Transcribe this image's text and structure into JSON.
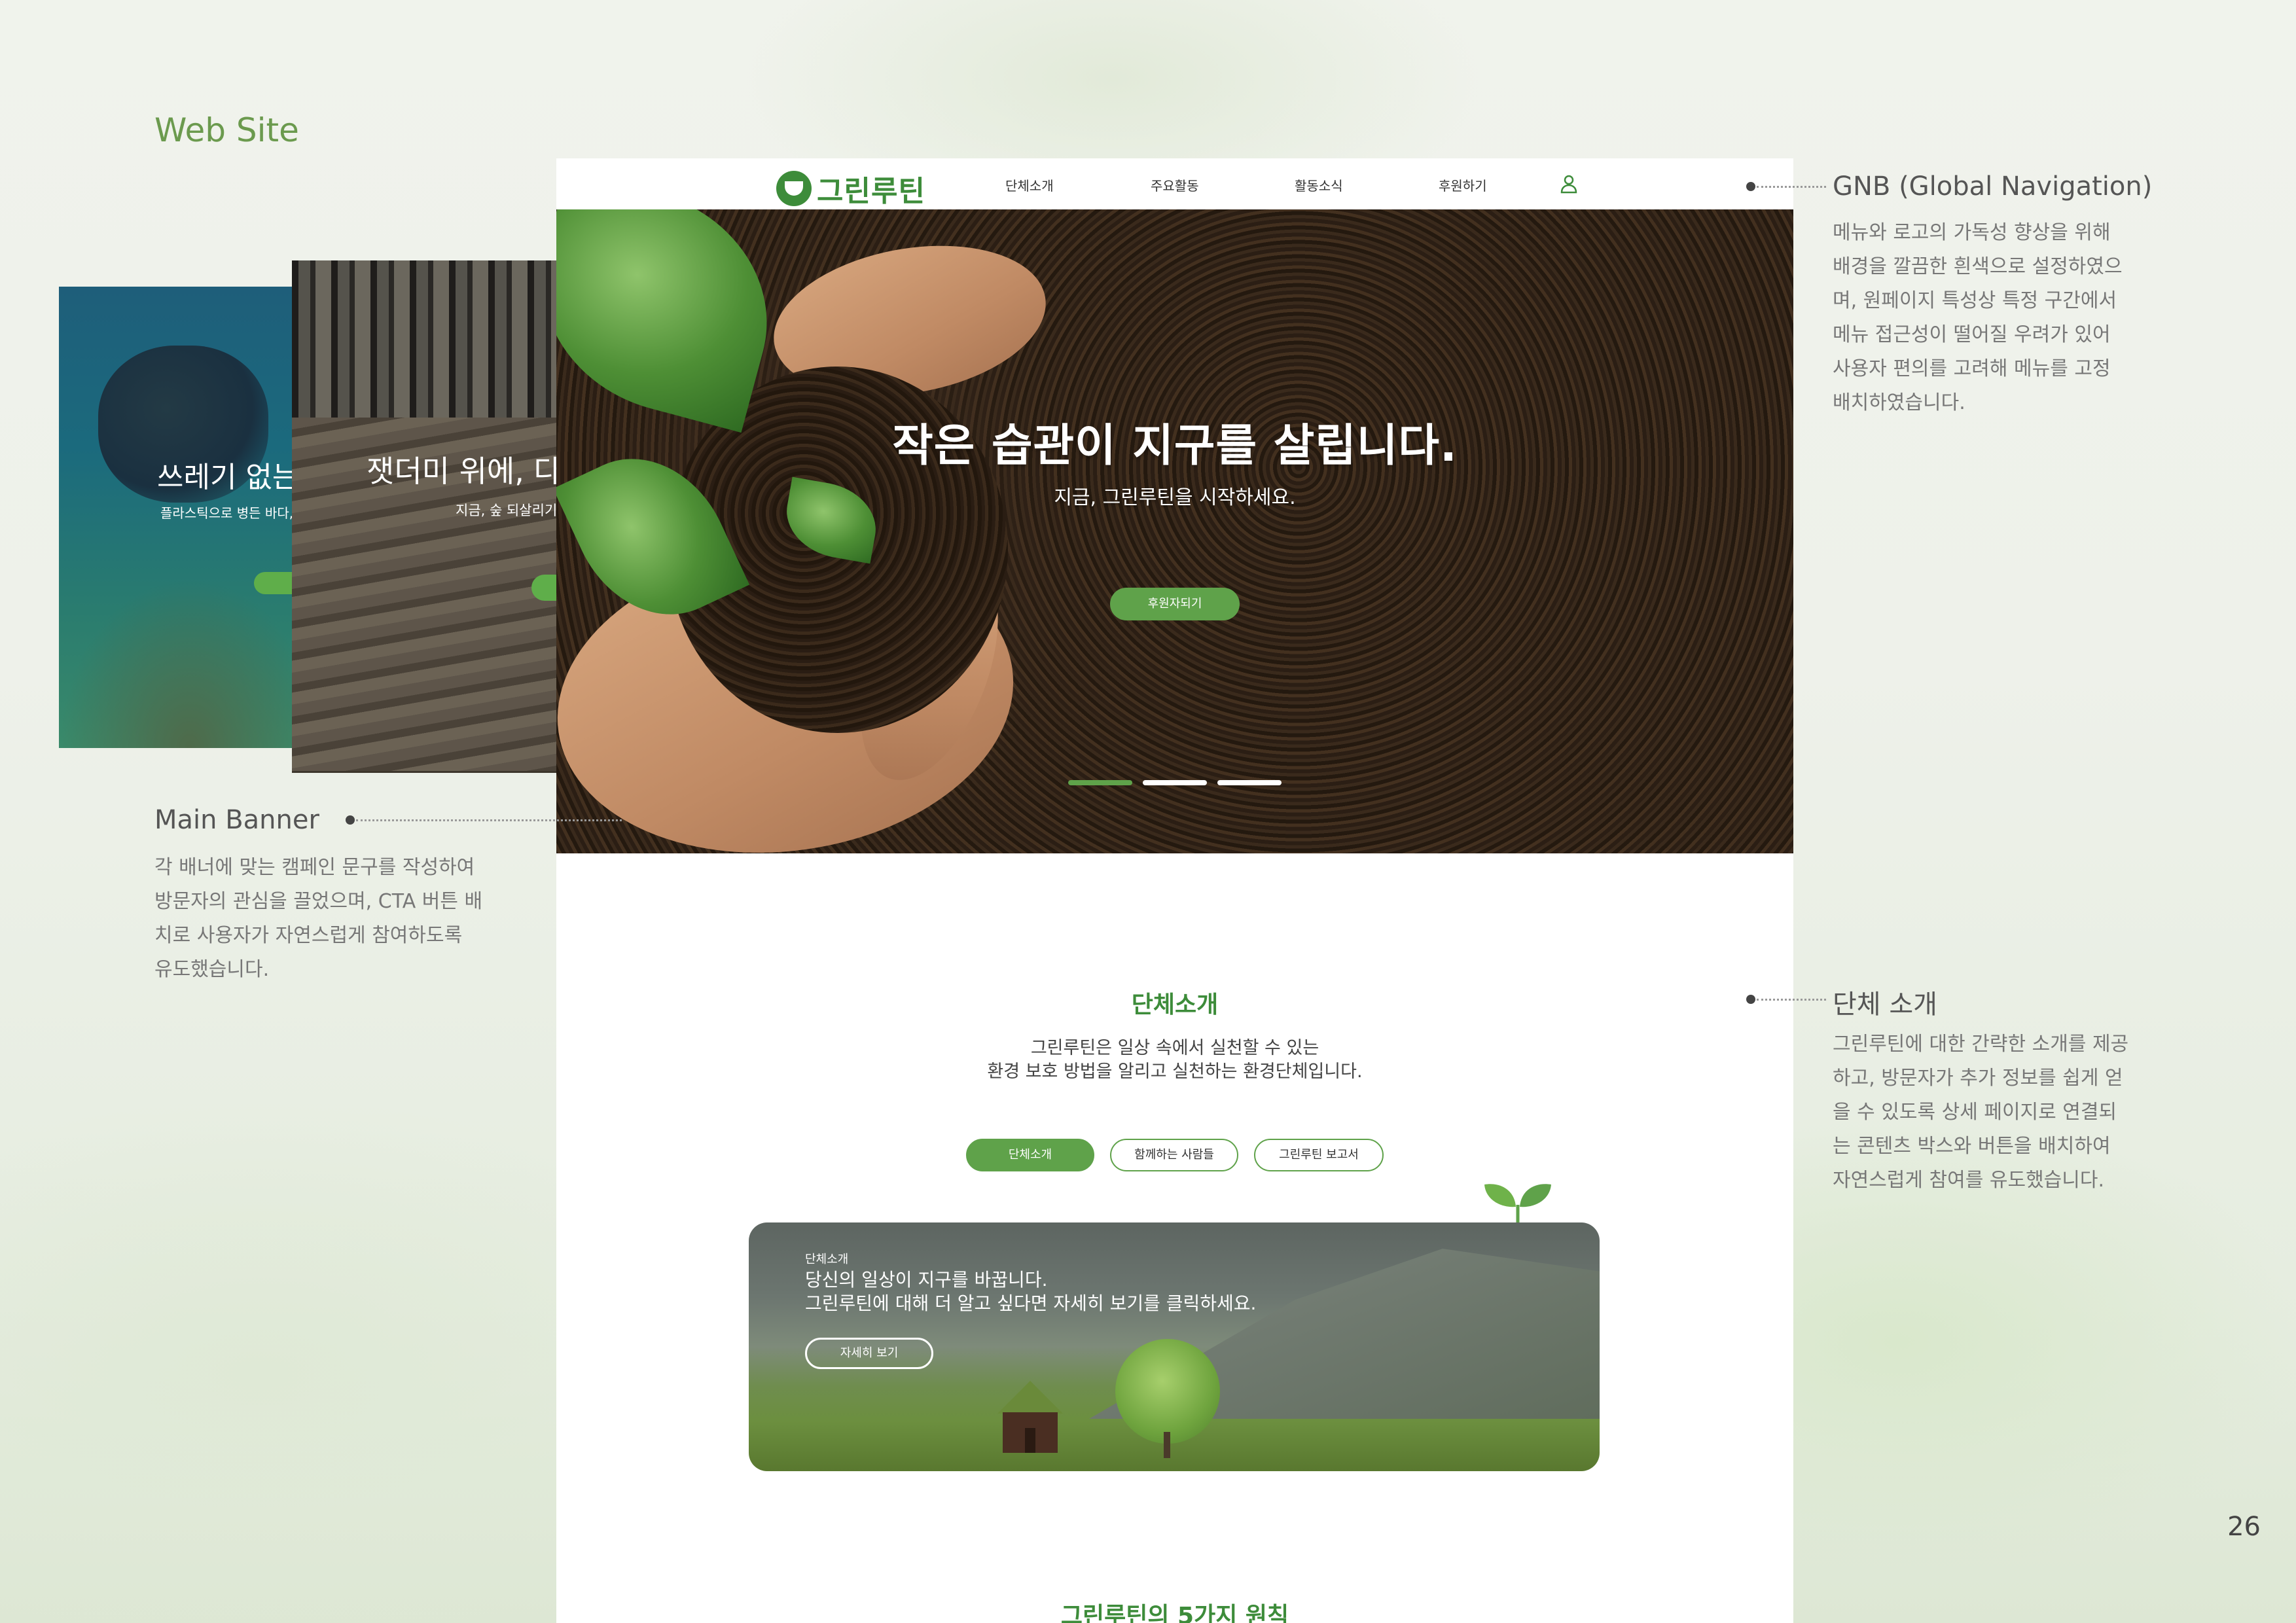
{
  "heading": "Web Site",
  "page_number": "26",
  "annotations": {
    "gnb": {
      "title": "GNB (Global Navigation)",
      "body": "메뉴와 로고의 가독성 향상을 위해\n배경을 깔끔한 흰색으로 설정하였으\n며, 원페이지 특성상 특정 구간에서\n메뉴 접근성이 떨어질 우려가 있어\n사용자 편의를 고려해 메뉴를 고정\n배치하였습니다."
    },
    "main_banner": {
      "title": "Main Banner",
      "body": "각 배너에 맞는 캠페인 문구를 작성하여\n방문자의 관심을 끌었으며, CTA 버튼 배\n치로 사용자가 자연스럽게 참여하도록\n유도했습니다."
    },
    "about": {
      "title": "단체 소개",
      "body": "그린루틴에 대한 간략한 소개를 제공\n하고, 방문자가 추가 정보를 쉽게 얻\n을 수 있도록 상세 페이지로 연결되\n는 콘텐츠 박스와 버튼을 배치하여\n자연스럽게 참여를 유도했습니다."
    }
  },
  "side_banners": [
    {
      "title": "쓰레기 없는",
      "subtitle": "플라스틱으로 병든 바다,"
    },
    {
      "title": "잿더미 위에, 다",
      "subtitle": "지금, 숲 되살리기"
    }
  ],
  "site": {
    "logo": "그린루틴",
    "nav": [
      "단체소개",
      "주요활동",
      "활동소식",
      "후원하기"
    ],
    "hero": {
      "title": "작은 습관이 지구를 살립니다.",
      "subtitle": "지금, 그린루틴을 시작하세요.",
      "cta": "후원자되기",
      "active_slide": 1,
      "slide_count": 3
    },
    "about": {
      "title": "단체소개",
      "description": "그린루틴은 일상 속에서 실천할 수 있는\n환경 보호 방법을 알리고 실천하는 환경단체입니다.",
      "tabs": [
        "단체소개",
        "함께하는 사람들",
        "그린루틴 보고서"
      ],
      "active_tab": 0,
      "box": {
        "label": "단체소개",
        "text": "당신의 일상이 지구를 바꿉니다.\n그린루틴에 대해 더 알고 싶다면 자세히 보기를 클릭하세요.",
        "button": "자세히 보기"
      }
    },
    "principles_title": "그린루틴의 5가지 원칙"
  },
  "colors": {
    "brand_green": "#3d8c3a",
    "button_green": "#5fa24a",
    "heading_green": "#6b9a4e"
  }
}
